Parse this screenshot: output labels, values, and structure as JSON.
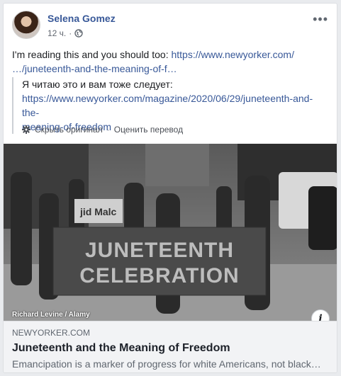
{
  "post": {
    "author": "Selena Gomez",
    "time": "12 ч.",
    "privacy_icon": "globe-icon",
    "menu_icon": "more-options-icon",
    "text_prefix": "I'm reading this and you should too: ",
    "link_line1": "https://www.newyorker.com/",
    "link_line2": "…/juneteenth-and-the-meaning-of-f…"
  },
  "translation": {
    "text": "Я читаю это и вам тоже следует:",
    "link_line1": "https://www.newyorker.com/magazine/2020/06/29/juneteenth-and-the-",
    "link_line2": "meaning-of-freedom"
  },
  "translate_bar": {
    "hide_original": "Скрыть оригинал",
    "rate_translation": "Оценить перевод"
  },
  "photo": {
    "banner_line1": "JUNETEENTH",
    "banner_line2": "CELEBRATION",
    "sign_text": "jid Malc",
    "credit": "Richard Levine / Alamy"
  },
  "link_preview": {
    "domain": "NEWYORKER.COM",
    "title": "Juneteenth and the Meaning of Freedom",
    "description": "Emancipation is a marker of progress for white Americans, not black…"
  },
  "colors": {
    "link": "#385898",
    "preview_bg": "#f2f3f5"
  }
}
